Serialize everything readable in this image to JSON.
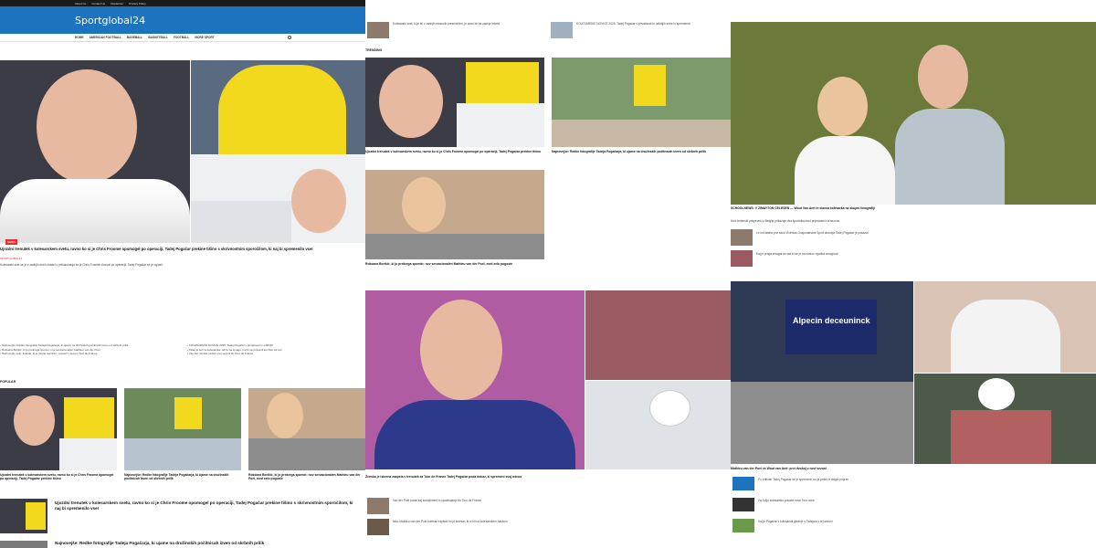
{
  "site": {
    "topbar_links": [
      "About Us",
      "Contact Us",
      "Disclaimer",
      "Privacy Policy"
    ],
    "brand": "Sportglobal24",
    "nav": [
      "HOME",
      "AMERICAN FOOTBALL",
      "BASEBALL",
      "BASKETBALL",
      "FOOTBALL",
      "MORE SPORT"
    ]
  },
  "col1": {
    "hero_headline": "Ujozdni trenutek v kolesarskem svetu, ravno ko si je Chris Froome opomogel po operaciji, Tadej Pogačar prekine tišino s skrivnostnim sporočilom, ki naj bi spremenilo vse!",
    "hero_author": "SPORTGLOBAL24",
    "hero_lead": "Kolesarski svet se je v zadnjih dneh znašel v pričakovanju ko je Chris Froome okreval po operaciji. Tadej Pogačar se je oglasil.",
    "bullets_left": [
      "Najnovejše: Redke fotografije Tadeja Pogačarja, ki ujame na družinskih počitnicah izven od skrbnih prilik",
      "Roksana Borikić, ki jo prekrega spomin: nov senzacionalen Mathieu van der Poel",
      "Najnovejše zelo: kolesar, ki je skoraj resničen, preseči v sezoni Tour de France"
    ],
    "bullets_right": [
      "KOLESARSKE NOVICE 2025: Tadej Pogačar v privatnosti in odkritjih",
      "Tadej je šel na kolesarska: odziv na zmage, naj bi se pripravil kot čisti od ovir",
      "Vse kar morate vedeti o tej sezoni do Tour de France"
    ],
    "section_label": "POPULAR",
    "cards": [
      {
        "headline": "Ujozdni trenutek v kolesarskem svetu, ravno ko si je Chris Froome opomogel po operaciji, Tadej Pogačar prekine tišino"
      },
      {
        "headline": "Najnovejše: Redke fotografije Tadeja Pogačarja, ki ujame na družinskih počitnicah izven od skrbnih prilik"
      },
      {
        "headline": "Roksana Borikić, ki jo prekrega spomin: nov senzacionalen Mathieu van der Poel, med zelo pogoste"
      }
    ],
    "list_items": [
      {
        "headline": "Ujozdni trenutek v kolesarskem svetu, ravno ko si je Chris Froome opomogel po operaciji, Tadej Pogačar prekine tišino s skrivnostnim sporočilom, ki naj bi spremenilo vse!"
      },
      {
        "headline": "Najnovejše: Redke fotografije Tadeja Pogačarja, ki ujame na družinskih počitnicah izven od skrbnih prilik"
      }
    ]
  },
  "col2": {
    "top_items": [
      {
        "headline": "Kolesarski svet, ki je bil v zadnjih mesecih presenečen, je smel že na zadnje tekme"
      },
      {
        "headline": "KOLESARSKE NOVICE 2025: Tadej Pogačar v privatnosti in odkritjih sebe in sprememb"
      }
    ],
    "section_label": "TRENDING",
    "trend_items": [
      {
        "headline": "Ujozdni trenutek v kolesarskem svetu, ravno ko si je Chris Froome opomogel po operaciji, Tadej Pogačar prekine tišino"
      },
      {
        "headline": "Najnovejše: Redke fotografije Tadeja Pogačarja, ki ujame na družinskih počitnicah izven od skrbnih prilik"
      }
    ],
    "mid_headline": "Roksana Borikić, ki jo prekrega spomin: nov senzacionalen Mathieu van der Poel, med zelo pogoste",
    "big_headline": "Ženska je iskrena zaspela v trenutek za Tour de France Tadej Pogačar poda dokaz, ki spremeni svoj odnos",
    "small_items": [
      {
        "headline": "Van der Poel podal kaj kompliment in spodbujanje do Tour de France"
      },
      {
        "headline": "Niko Mathieu van der Poel kolesar napisal: ko je kolesar, ki ni bil na kolesarskem naslovu"
      }
    ]
  },
  "col3": {
    "hero_headline": "SCHOOLNEWS: V ZIMAYTON CELESEN — Wout Van Aert in slavna kolesarka na skupni fotografiji",
    "hero_lead": "Novi tedenski prispevek iz Belgije prikazuje dva športnika med pripravami na sezono.",
    "small_items": [
      {
        "headline": "Le kot lastna prvi skok Viverkas Gospodarstva Sport obdobja Tadej Pogačar je pokazal"
      },
      {
        "headline": "Kaj je praga zmagal za vse ki se je na naslov zgodba zmagoval"
      }
    ],
    "alpecin_text": "Alpecin deceuninck",
    "mid_headline": "Mathieu van der Poel vs Wout van Aert: prvi dvoboj v novi sezoni",
    "tail_items": [
      {
        "headline": "Po trditvah Tadej Pogačar se je spremenil, ko je prišel iz dolgih priprav"
      },
      {
        "headline": "Za Julijo kolesarsko pokaže nove Tour nove"
      },
      {
        "headline": "Kaj je Pogačar v kolesarski gibanje s Tadejom v tej sezoni"
      }
    ]
  },
  "colors": {
    "brand_blue": "#1e73be",
    "tag_red": "#e63030",
    "topbar": "#1a1a1a"
  }
}
